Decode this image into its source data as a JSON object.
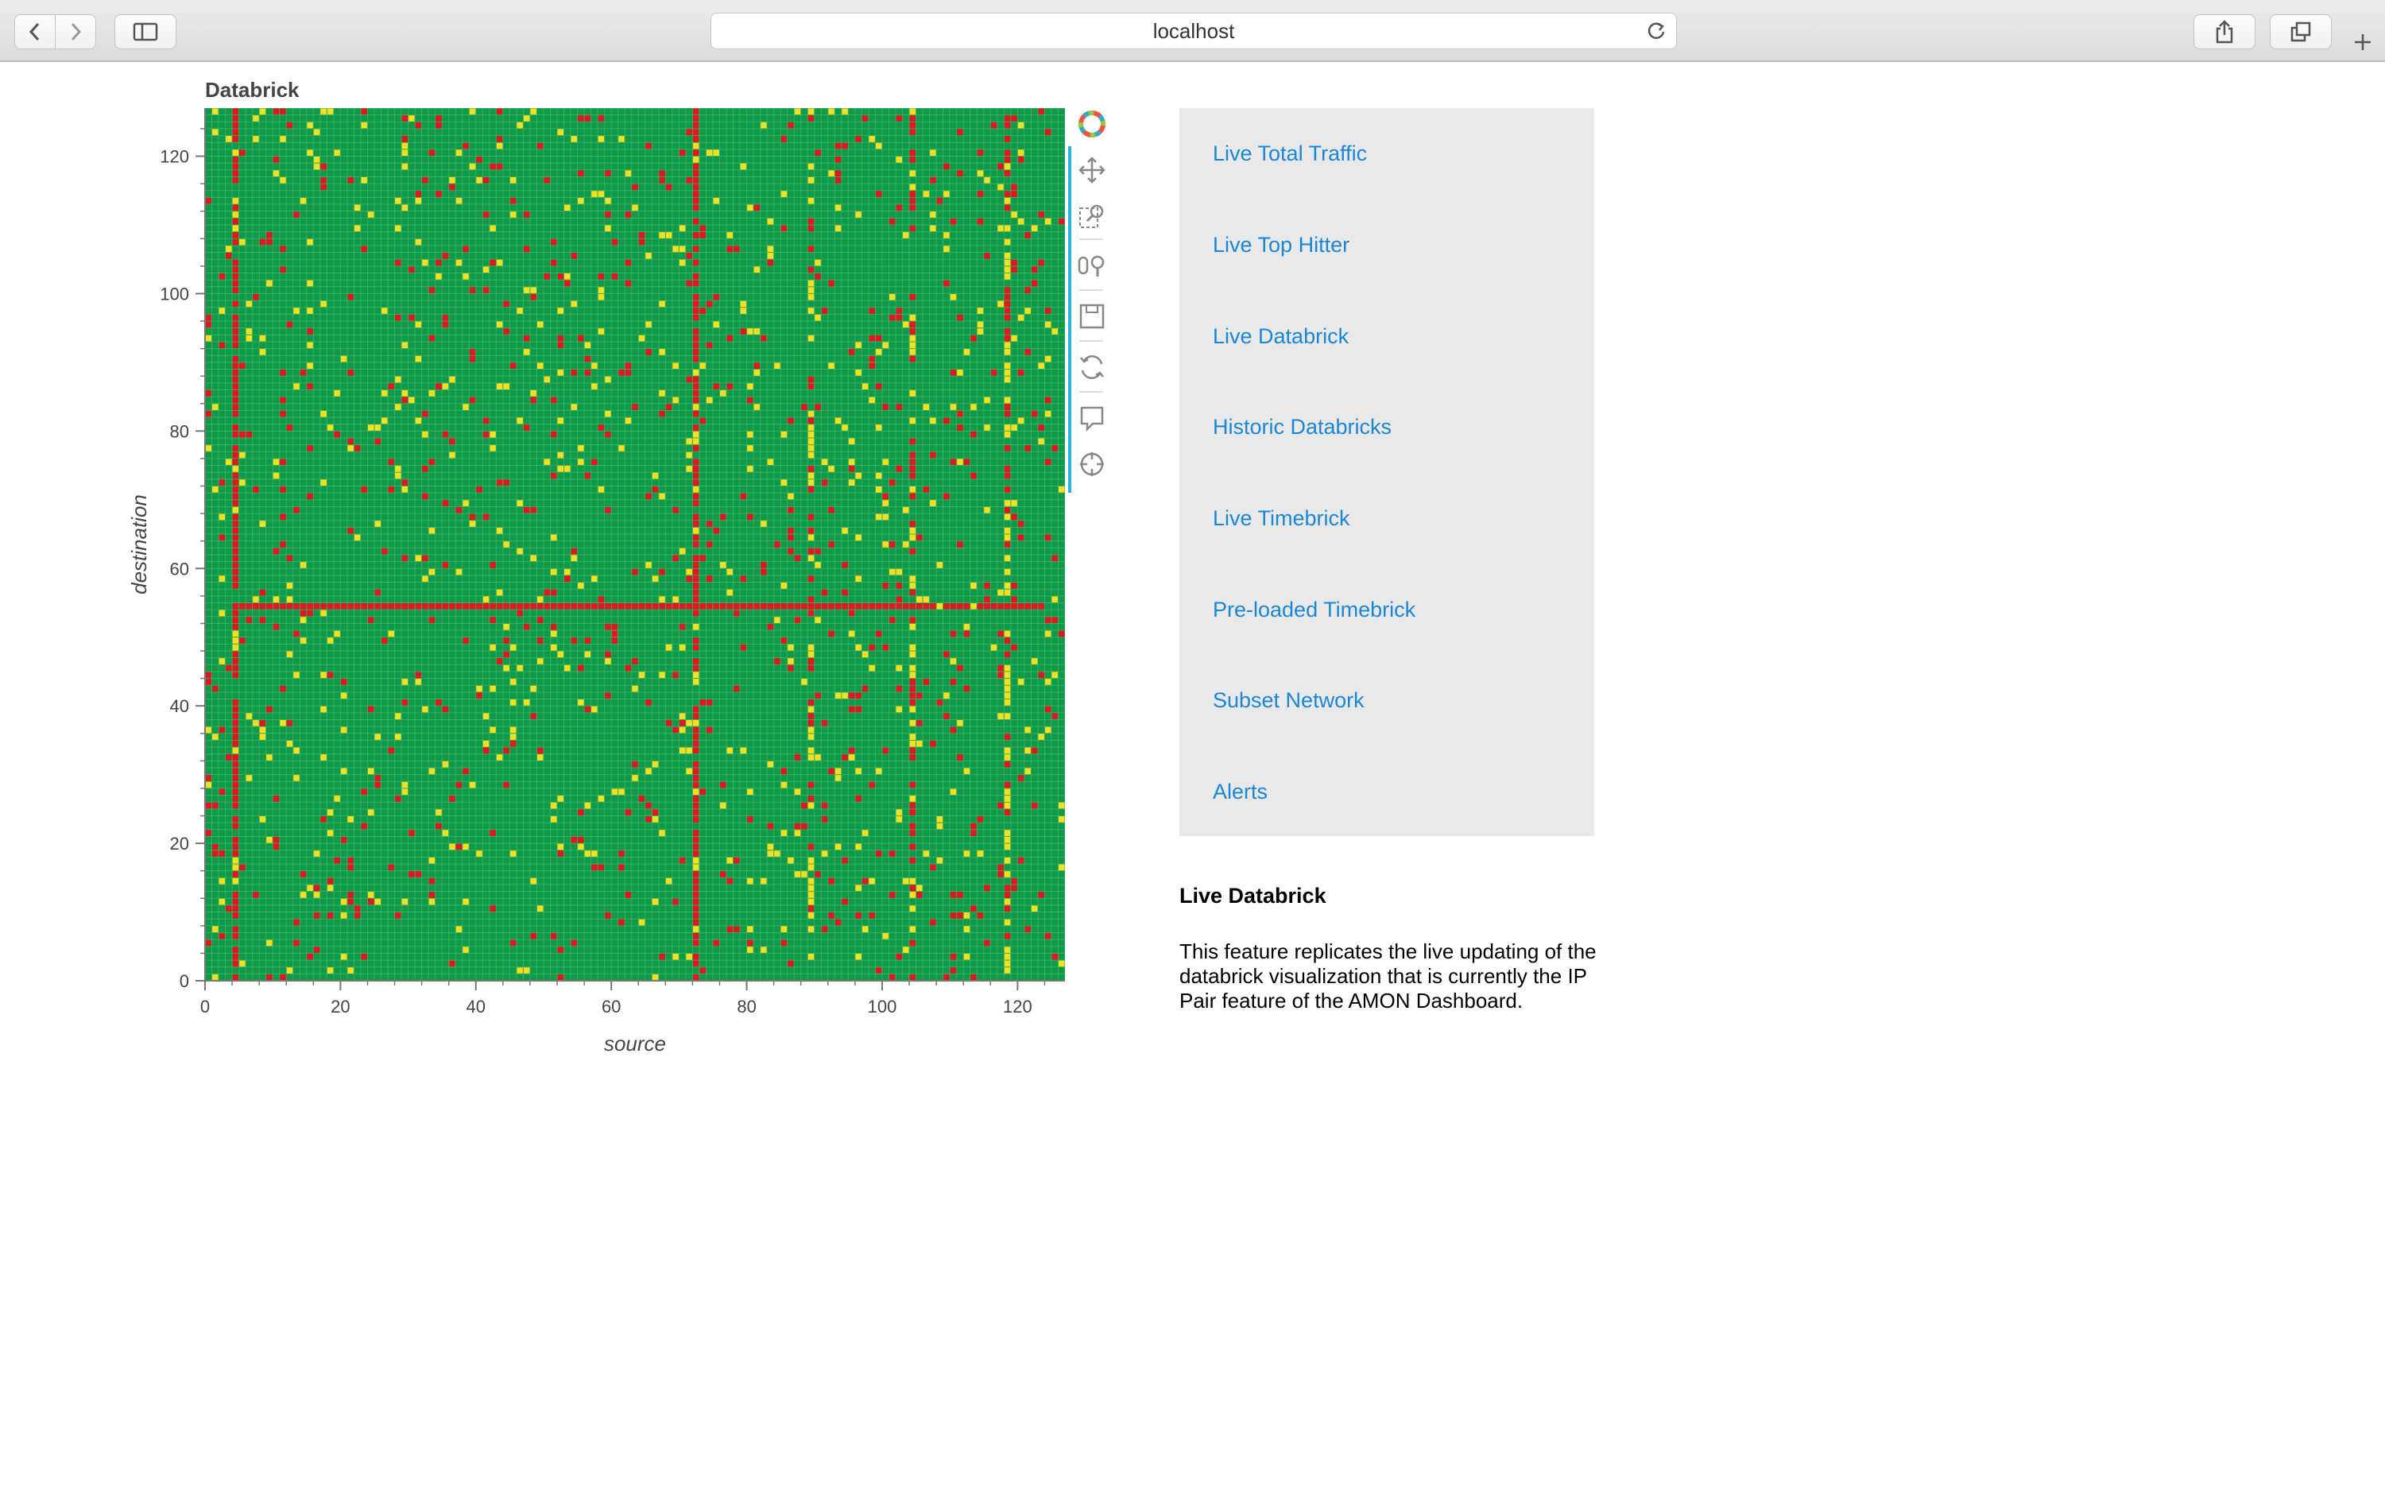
{
  "browser": {
    "url": "localhost"
  },
  "plot": {
    "title": "Databrick",
    "colors": {
      "background": "#0f9a48",
      "grid": "#56c07e",
      "low": "#f2e021",
      "high": "#e0171e"
    },
    "tools": [
      "bokeh-logo-icon",
      "pan-icon",
      "box-zoom-icon",
      "wheel-zoom-icon",
      "save-icon",
      "reset-icon",
      "hover-icon",
      "crosshair-icon"
    ]
  },
  "chart_data": {
    "type": "heatmap",
    "title": "Databrick",
    "xlabel": "source",
    "ylabel": "destination",
    "xlim": [
      0,
      127
    ],
    "ylim": [
      0,
      127
    ],
    "x_ticks": [
      0,
      20,
      40,
      60,
      80,
      100,
      120
    ],
    "y_ticks": [
      0,
      20,
      40,
      60,
      80,
      100,
      120
    ],
    "x_tick_labels": [
      "0",
      "20",
      "40",
      "60",
      "80",
      "100",
      "120"
    ],
    "y_tick_labels": [
      "0",
      "20",
      "40",
      "60",
      "80",
      "100",
      "120"
    ],
    "grid": true,
    "base_color": "green",
    "color_scale": [
      "green",
      "yellow",
      "red"
    ],
    "dense_columns_red": [
      4,
      72
    ],
    "dense_columns_mixed": [
      89,
      104,
      118
    ],
    "dense_rows_red": [
      54
    ],
    "note_cells": "remaining yellow and red cells are scattered sparsely across the grid"
  },
  "nav": {
    "links": [
      "Live Total Traffic",
      "Live Top Hitter",
      "Live Databrick",
      "Historic Databricks",
      "Live Timebrick",
      "Pre-loaded Timebrick",
      "Subset Network",
      "Alerts"
    ]
  },
  "description": {
    "title": "Live Databrick",
    "text": "This feature replicates the live updating of the databrick visualization that is currently the IP Pair feature of the AMON Dashboard."
  }
}
